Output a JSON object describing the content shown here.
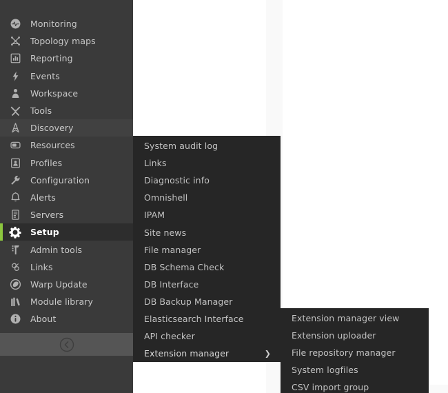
{
  "theme": {
    "sidebar_bg": "#3a3a3a",
    "sidebar_active_bg": "#2d2d2d",
    "accent": "#8cc63e",
    "submenu_bg": "#262626",
    "text": "#c9c9c9",
    "content_bg": "#ffffff",
    "gutter_bg": "#f9f9f9",
    "collapse_bar_bg": "#555555"
  },
  "sidebar": {
    "collapse_label": "",
    "items": [
      {
        "label": "Monitoring",
        "icon": "pulse-circle-icon",
        "state": "normal"
      },
      {
        "label": "Topology maps",
        "icon": "topology-icon",
        "state": "normal"
      },
      {
        "label": "Reporting",
        "icon": "bar-chart-box-icon",
        "state": "normal"
      },
      {
        "label": "Events",
        "icon": "lightning-bolt-icon",
        "state": "normal"
      },
      {
        "label": "Workspace",
        "icon": "person-icon",
        "state": "normal"
      },
      {
        "label": "Tools",
        "icon": "tools-icon",
        "state": "normal"
      },
      {
        "label": "Discovery",
        "icon": "compass-needle-icon",
        "state": "hovered"
      },
      {
        "label": "Resources",
        "icon": "resource-box-icon",
        "state": "normal"
      },
      {
        "label": "Profiles",
        "icon": "profile-card-icon",
        "state": "normal"
      },
      {
        "label": "Configuration",
        "icon": "wrench-icon",
        "state": "normal"
      },
      {
        "label": "Alerts",
        "icon": "bell-icon",
        "state": "normal"
      },
      {
        "label": "Servers",
        "icon": "server-rack-icon",
        "state": "normal"
      },
      {
        "label": "Setup",
        "icon": "gear-icon",
        "state": "active"
      },
      {
        "label": "Admin tools",
        "icon": "admin-hammer-icon",
        "state": "normal"
      },
      {
        "label": "Links",
        "icon": "chain-links-icon",
        "state": "normal"
      },
      {
        "label": "Warp Update",
        "icon": "warp-update-icon",
        "state": "normal"
      },
      {
        "label": "Module library",
        "icon": "books-icon",
        "state": "normal"
      },
      {
        "label": "About",
        "icon": "info-circle-icon",
        "state": "normal"
      }
    ]
  },
  "submenu_setup": {
    "parent": "Setup",
    "items": [
      {
        "label": "System audit log",
        "has_arrow": false
      },
      {
        "label": "Links",
        "has_arrow": false
      },
      {
        "label": "Diagnostic info",
        "has_arrow": false
      },
      {
        "label": "Omnishell",
        "has_arrow": false
      },
      {
        "label": "IPAM",
        "has_arrow": false
      },
      {
        "label": "Site news",
        "has_arrow": false
      },
      {
        "label": "File manager",
        "has_arrow": false
      },
      {
        "label": "DB Schema Check",
        "has_arrow": false
      },
      {
        "label": "DB Interface",
        "has_arrow": false
      },
      {
        "label": "DB Backup Manager",
        "has_arrow": false
      },
      {
        "label": "Elasticsearch Interface",
        "has_arrow": false
      },
      {
        "label": "API checker",
        "has_arrow": false
      },
      {
        "label": "Extension manager",
        "has_arrow": true
      }
    ]
  },
  "submenu_extension": {
    "parent": "Extension manager",
    "items": [
      {
        "label": "Extension manager view",
        "has_arrow": false
      },
      {
        "label": "Extension uploader",
        "has_arrow": false
      },
      {
        "label": "File repository manager",
        "has_arrow": false
      },
      {
        "label": "System logfiles",
        "has_arrow": false
      },
      {
        "label": "CSV import group",
        "has_arrow": false
      }
    ]
  },
  "icons": {
    "arrow_right_glyph": "❯",
    "collapse_icon": "chevron-left-circle-icon"
  }
}
